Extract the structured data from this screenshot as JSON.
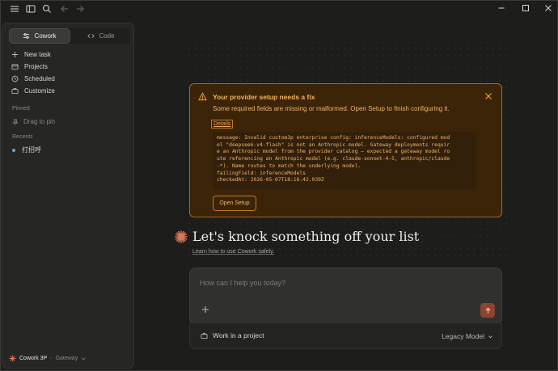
{
  "sidebar": {
    "mode_tabs": [
      {
        "label": "Cowork",
        "icon": "sliders-icon",
        "active": true
      },
      {
        "label": "Code",
        "icon": "code-icon",
        "active": false
      }
    ],
    "nav": [
      {
        "label": "New task",
        "icon": "plus-icon"
      },
      {
        "label": "Projects",
        "icon": "folder-icon"
      },
      {
        "label": "Scheduled",
        "icon": "clock-icon"
      },
      {
        "label": "Customize",
        "icon": "briefcase-icon"
      }
    ],
    "pinned_label": "Pinned",
    "pin_hint": "Drag to pin",
    "recents_label": "Recents",
    "recents": [
      "打招呼"
    ],
    "account": {
      "name": "Cowork 3P",
      "separator": "·",
      "plan": "Gateway"
    }
  },
  "alert": {
    "title": "Your provider setup needs a fix",
    "body": "Some required fields are missing or malformed. Open Setup to finish configuring it.",
    "details_label": "Details",
    "error_text": "message: Invalid custom3p enterprise config: inferenceModels: configured mod\nel \"deepseek-v4-flash\" is not an Anthropic model. Gateway deployments requir\ne an Anthropic model from the provider catalog — expected a gateway model ro\nute referencing an Anthropic model (e.g. claude-sonnet-4-5, anthropic/claude\n-*). Name routes to match the underlying model.\nfailingField: inferenceModels\ncheckedAt: 2026-05-07T18:16:42.039Z",
    "open_setup_label": "Open Setup",
    "accent": "#f0a447"
  },
  "main": {
    "hero_title": "Let's knock something off your list",
    "learn_link": "Learn how to use Cowork safely.",
    "composer_placeholder": "How can I help you today?",
    "project_label": "Work in a project",
    "model_label": "Legacy Model",
    "brand_color": "#d97757"
  }
}
